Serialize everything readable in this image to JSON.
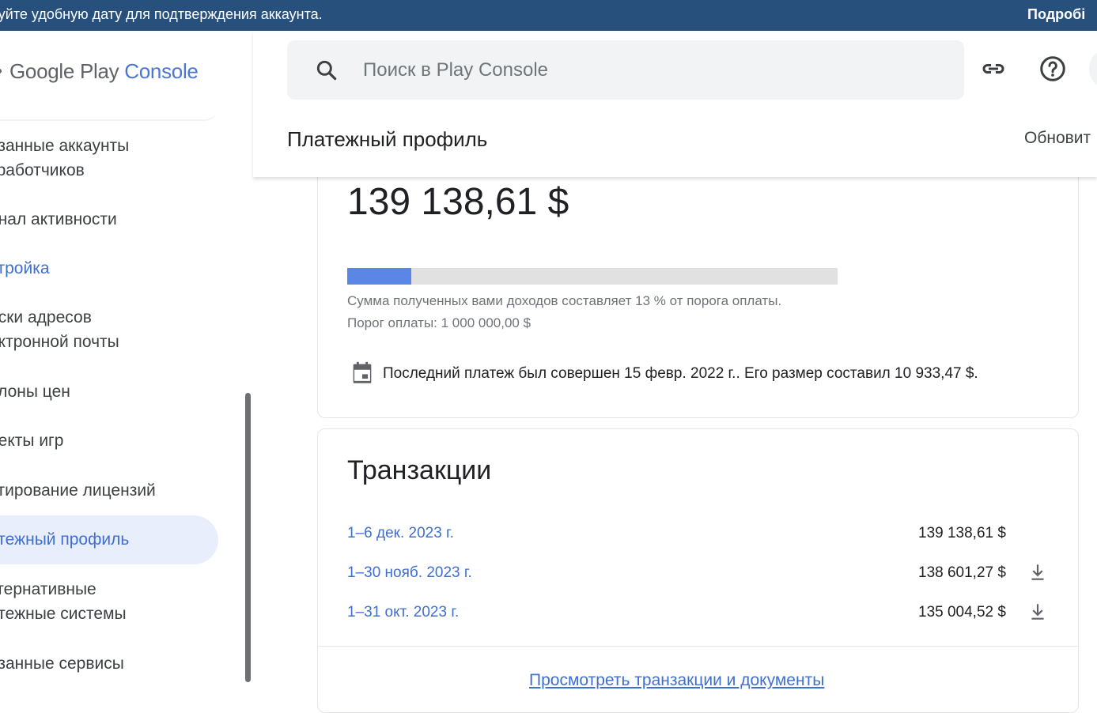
{
  "banner": {
    "message": "руйте удобную дату для подтверждения аккаунта.",
    "more_link": "Подробі"
  },
  "logo": {
    "google_play": "Google Play",
    "console": "Console"
  },
  "sidebar": {
    "items": [
      {
        "label_line1": "язанные аккаунты",
        "label_line2": "зработчиков",
        "state": "normal"
      },
      {
        "label_line1": "рнал активности",
        "state": "normal"
      },
      {
        "label_line1": "стройка",
        "state": "link"
      },
      {
        "label_line1": "иски адресов",
        "label_line2": "ектронной почты",
        "state": "normal"
      },
      {
        "label_line1": "блоны цен",
        "state": "normal"
      },
      {
        "label_line1": "оекты игр",
        "state": "normal"
      },
      {
        "label_line1": "стирование лицензий",
        "state": "normal"
      },
      {
        "label_line1": "атежный профиль",
        "state": "active"
      },
      {
        "label_line1": "ьтернативные",
        "label_line2": "атежные системы",
        "state": "normal"
      },
      {
        "label_line1": "язанные сервисы",
        "state": "normal"
      }
    ]
  },
  "search": {
    "placeholder": "Поиск в Play Console"
  },
  "header": {
    "page_title": "Платежный профиль",
    "update_label": "Обновит"
  },
  "balance": {
    "amount": "139 138,61 $",
    "progress_fraction": 0.13,
    "note_percent": "Сумма полученных вами доходов составляет 13 % от порога оплаты.",
    "note_threshold": "Порог оплаты: 1 000 000,00 $",
    "last_payment": "Последний платеж был совершен 15 февр. 2022 г.. Его размер составил 10 933,47 $."
  },
  "transactions": {
    "title": "Транзакции",
    "rows": [
      {
        "period": "1–6 дек. 2023 г.",
        "sum": "139 138,61 $",
        "downloadable": false
      },
      {
        "period": "1–30 нояб. 2023 г.",
        "sum": "138 601,27 $",
        "downloadable": true
      },
      {
        "period": "1–31 окт. 2023 г.",
        "sum": "135 004,52 $",
        "downloadable": true
      }
    ],
    "view_all": "Просмотреть транзакции и документы"
  },
  "colors": {
    "banner": "#28507d",
    "accent": "#3f6fd1",
    "progress_fill": "#5b86e6",
    "active_nav_bg": "#e8eefb"
  }
}
